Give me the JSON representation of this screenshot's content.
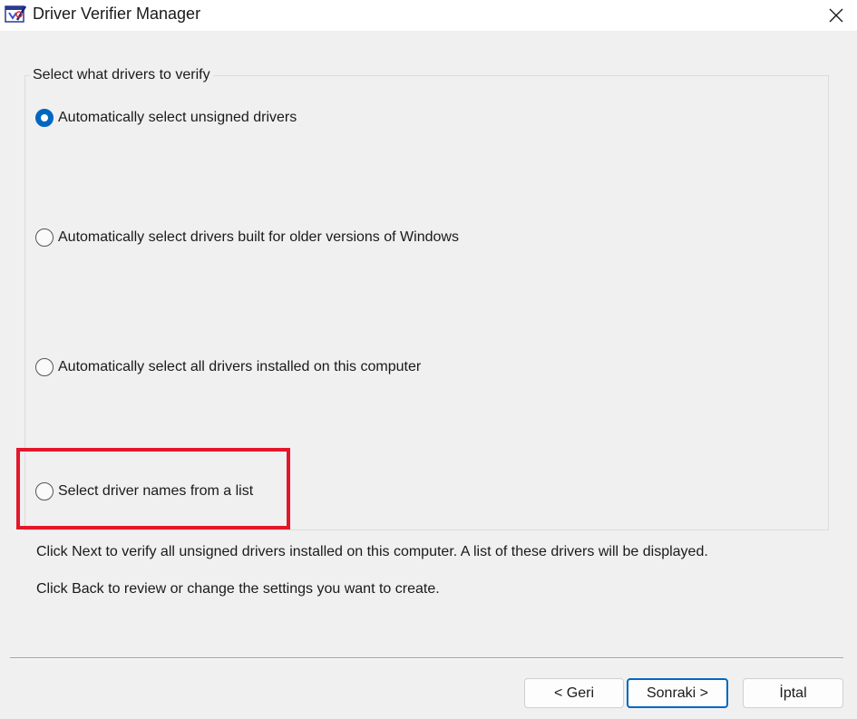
{
  "window": {
    "title": "Driver Verifier Manager",
    "app_icon": "driver-verifier-icon",
    "close_icon": "close-icon"
  },
  "group": {
    "legend": "Select what drivers to verify",
    "options": [
      {
        "label": "Automatically select unsigned drivers",
        "checked": true
      },
      {
        "label": "Automatically select drivers built for older versions of Windows",
        "checked": false
      },
      {
        "label": "Automatically select all drivers installed on this computer",
        "checked": false
      },
      {
        "label": "Select driver names from a list",
        "checked": false
      }
    ]
  },
  "info": {
    "line1": "Click Next to verify all unsigned drivers installed on this computer. A list of these drivers will be displayed.",
    "line2": "Click Back to review or change the settings you want to create."
  },
  "buttons": {
    "back": "< Geri",
    "next": "Sonraki >",
    "cancel": "İptal"
  },
  "colors": {
    "accent": "#0067c0",
    "highlight": "#e3172b",
    "background": "#f0f0f0"
  }
}
